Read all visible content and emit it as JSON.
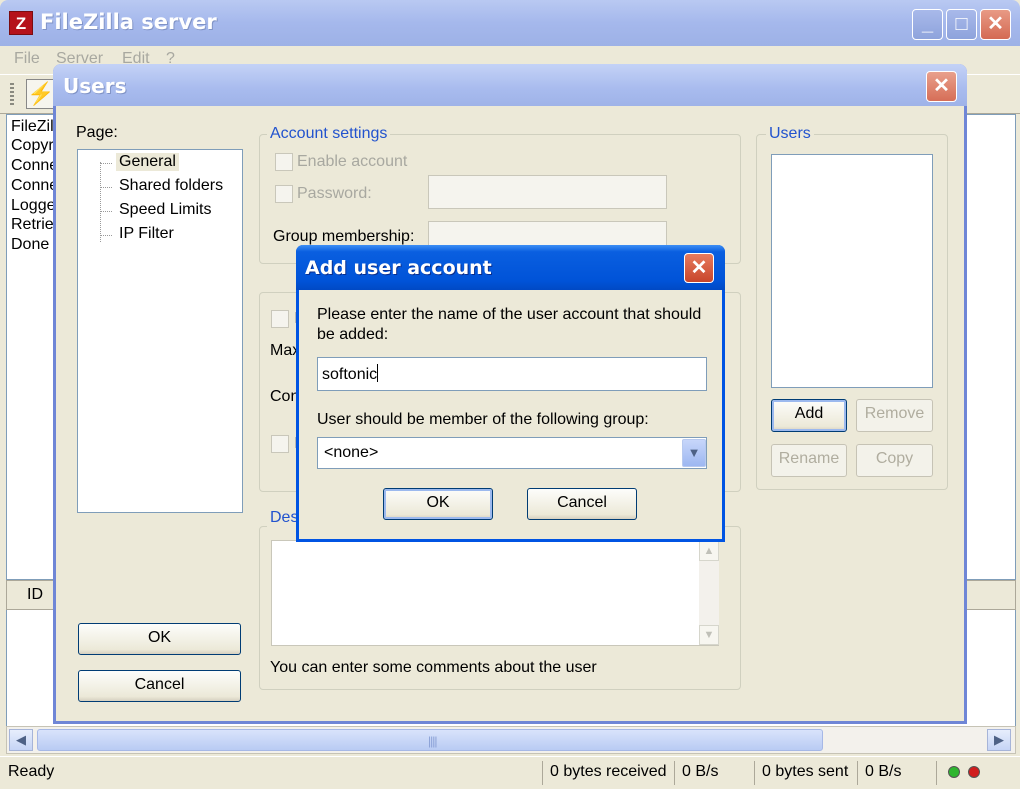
{
  "app": {
    "title": "FileZilla server",
    "icon_letter": "Z",
    "window_controls": {
      "minimize": "_",
      "maximize": "□",
      "close": "✕"
    }
  },
  "menu": [
    "File",
    "Server",
    "Edit",
    "?"
  ],
  "toolbar": {
    "connect_icon": "⚡"
  },
  "log_lines": [
    "FileZil",
    "Copyr",
    "Conne",
    "Conne",
    "Logge",
    "Retrie",
    "Done"
  ],
  "connections": {
    "column_id": "ID"
  },
  "scrollbar": {
    "left": "◀",
    "right": "▶",
    "grip": "||||"
  },
  "statusbar": {
    "ready": "Ready",
    "bytes_received": "0 bytes received",
    "recv_rate": "0 B/s",
    "bytes_sent": "0 bytes sent",
    "send_rate": "0 B/s"
  },
  "users_dialog": {
    "title": "Users",
    "close": "✕",
    "page_label": "Page:",
    "pages": [
      "General",
      "Shared folders",
      "Speed Limits",
      "IP Filter"
    ],
    "selected_page": "General",
    "ok": "OK",
    "cancel": "Cancel",
    "account_settings": {
      "title": "Account settings",
      "enable_account": "Enable account",
      "password": "Password:",
      "group_membership": "Group membership:"
    },
    "limits": {
      "b_partial": "B",
      "max_partial": "Max",
      "con_partial": "Con",
      "f_partial": "F"
    },
    "description": {
      "title_partial": "Des",
      "hint": "You can enter some comments about the user",
      "scroll_up": "▲",
      "scroll_down": "▼"
    },
    "users_panel": {
      "title": "Users",
      "add": "Add",
      "remove": "Remove",
      "rename": "Rename",
      "copy": "Copy"
    }
  },
  "add_user_dialog": {
    "title": "Add user account",
    "close": "✕",
    "prompt": "Please enter the name of the user account that should be added:",
    "name_value": "softonic",
    "group_label": "User should be member of the following group:",
    "group_selected": "<none>",
    "dropdown_arrow": "▼",
    "ok": "OK",
    "cancel": "Cancel"
  },
  "colors": {
    "active_titlebar": "#0054e3",
    "inactive_titlebar": "#a5b8ec",
    "group_title": "#2253ce",
    "led_green": "#2fb52f",
    "led_red": "#d01e1e"
  }
}
